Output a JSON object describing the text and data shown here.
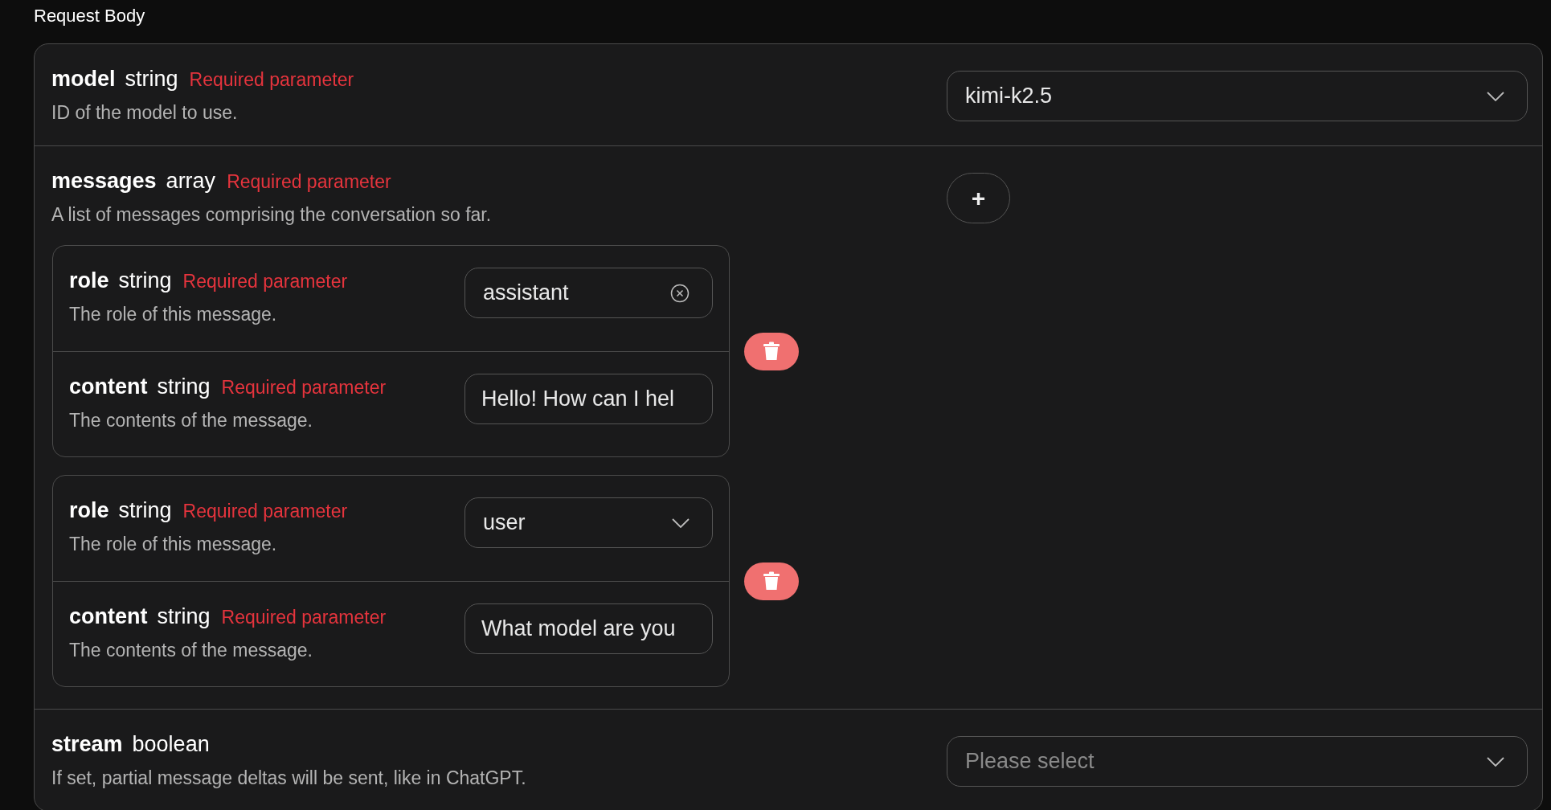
{
  "section_title": "Request Body",
  "params": [
    {
      "name": "model",
      "type": "string",
      "required_label": "Required parameter",
      "description": "ID of the model to use.",
      "control": {
        "kind": "select",
        "value": "kimi-k2.5"
      }
    },
    {
      "name": "messages",
      "type": "array",
      "required_label": "Required parameter",
      "description": "A list of messages comprising the conversation so far.",
      "control": {
        "kind": "add",
        "label": "+"
      },
      "items": [
        {
          "fields": [
            {
              "name": "role",
              "type": "string",
              "required_label": "Required parameter",
              "description": "The role of this message.",
              "control": {
                "kind": "clearable",
                "value": "assistant"
              }
            },
            {
              "name": "content",
              "type": "string",
              "required_label": "Required parameter",
              "description": "The contents of the message.",
              "control": {
                "kind": "text",
                "value": "Hello! How can I hel"
              }
            }
          ]
        },
        {
          "fields": [
            {
              "name": "role",
              "type": "string",
              "required_label": "Required parameter",
              "description": "The role of this message.",
              "control": {
                "kind": "select",
                "value": "user"
              }
            },
            {
              "name": "content",
              "type": "string",
              "required_label": "Required parameter",
              "description": "The contents of the message.",
              "control": {
                "kind": "text",
                "value": "What model are you"
              }
            }
          ]
        }
      ]
    },
    {
      "name": "stream",
      "type": "boolean",
      "description": "If set, partial message deltas will be sent, like in ChatGPT.",
      "control": {
        "kind": "select",
        "placeholder": "Please select"
      }
    }
  ]
}
